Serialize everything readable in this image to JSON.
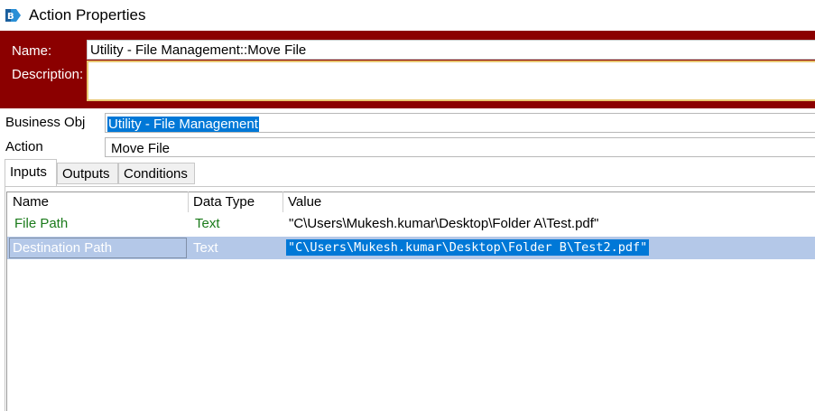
{
  "window": {
    "title": "Action Properties",
    "icon": "blue-prism-app-icon"
  },
  "header": {
    "name_label": "Name:",
    "name_value": "Utility - File Management::Move File",
    "description_label": "Description:",
    "description_value": "",
    "background_color": "#8b0000"
  },
  "fields": {
    "business_obj_label": "Business Obj",
    "business_obj_value": "Utility - File Management",
    "action_label": "Action",
    "action_value": "Move File"
  },
  "tabs": [
    {
      "label": "Inputs",
      "active": true
    },
    {
      "label": "Outputs",
      "active": false
    },
    {
      "label": "Conditions",
      "active": false
    }
  ],
  "grid": {
    "columns": [
      "Name",
      "Data Type",
      "Value"
    ],
    "rows": [
      {
        "name": "File Path",
        "type": "Text",
        "value": "\"C\\Users\\Mukesh.kumar\\Desktop\\Folder A\\Test.pdf\"",
        "selected": false
      },
      {
        "name": "Destination Path",
        "type": "Text",
        "value": "\"C\\Users\\Mukesh.kumar\\Desktop\\Folder B\\Test2.pdf\"",
        "selected": true
      }
    ]
  }
}
